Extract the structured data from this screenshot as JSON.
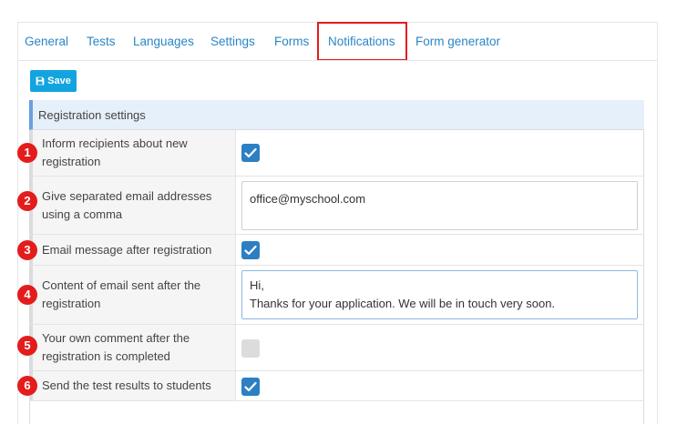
{
  "tabs": [
    {
      "label": "General"
    },
    {
      "label": "Tests"
    },
    {
      "label": "Languages"
    },
    {
      "label": "Settings"
    },
    {
      "label": "Forms"
    },
    {
      "label": "Notifications",
      "active": true
    },
    {
      "label": "Form generator"
    }
  ],
  "toolbar": {
    "save_label": "Save",
    "save_icon": "floppy-disk-icon"
  },
  "panel": {
    "title": "Registration settings"
  },
  "rows": [
    {
      "marker": "1",
      "label": "Inform recipients about new registration",
      "control": "checkbox",
      "checked": true
    },
    {
      "marker": "2",
      "label": "Give separated email addresses using a comma",
      "control": "text",
      "value": "office@myschool.com"
    },
    {
      "marker": "3",
      "label": "Email message after registration",
      "control": "checkbox",
      "checked": true
    },
    {
      "marker": "4",
      "label": "Content of email sent after the registration",
      "control": "textarea",
      "value": "Hi,\nThanks for your application. We will be in touch very soon."
    },
    {
      "marker": "5",
      "label": "Your own comment after the registration is completed",
      "control": "checkbox",
      "checked": false
    },
    {
      "marker": "6",
      "label": "Send the test results to students",
      "control": "checkbox",
      "checked": true
    }
  ],
  "colors": {
    "accent": "#2a86c6",
    "save_button": "#12a4de",
    "checkbox_on": "#2c7fc2",
    "marker": "#e41c1c",
    "highlight": "#e41c1c"
  }
}
